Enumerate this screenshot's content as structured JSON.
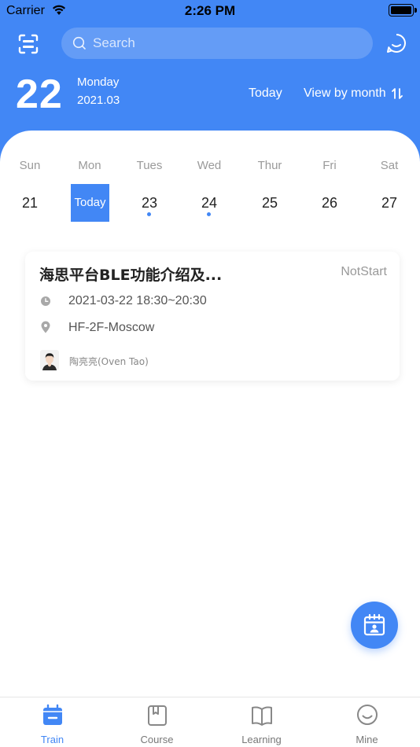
{
  "status_bar": {
    "carrier": "Carrier",
    "time": "2:26 PM"
  },
  "search": {
    "placeholder": "Search"
  },
  "date_header": {
    "day": "22",
    "weekday": "Monday",
    "year_month": "2021.03",
    "today_label": "Today",
    "view_label": "View by month"
  },
  "week": {
    "days": [
      "Sun",
      "Mon",
      "Tues",
      "Wed",
      "Thur",
      "Fri",
      "Sat"
    ],
    "dates": [
      "21",
      "Today",
      "23",
      "24",
      "25",
      "26",
      "27"
    ],
    "has_events": [
      false,
      false,
      true,
      true,
      false,
      false,
      false
    ]
  },
  "event": {
    "title": "海思平台BLE功能介绍及...",
    "status": "NotStart",
    "time": "2021-03-22 18:30~20:30",
    "location": "HF-2F-Moscow",
    "lecturer": "陶亮亮(Oven Tao)"
  },
  "tabs": [
    {
      "label": "Train",
      "icon": "calendar-icon",
      "active": true
    },
    {
      "label": "Course",
      "icon": "book-square-icon",
      "active": false
    },
    {
      "label": "Learning",
      "icon": "open-book-icon",
      "active": false
    },
    {
      "label": "Mine",
      "icon": "smiley-icon",
      "active": false
    }
  ],
  "colors": {
    "accent": "#4287f5",
    "header_bg": "#4287f5",
    "muted_text": "#9a9a9a"
  }
}
